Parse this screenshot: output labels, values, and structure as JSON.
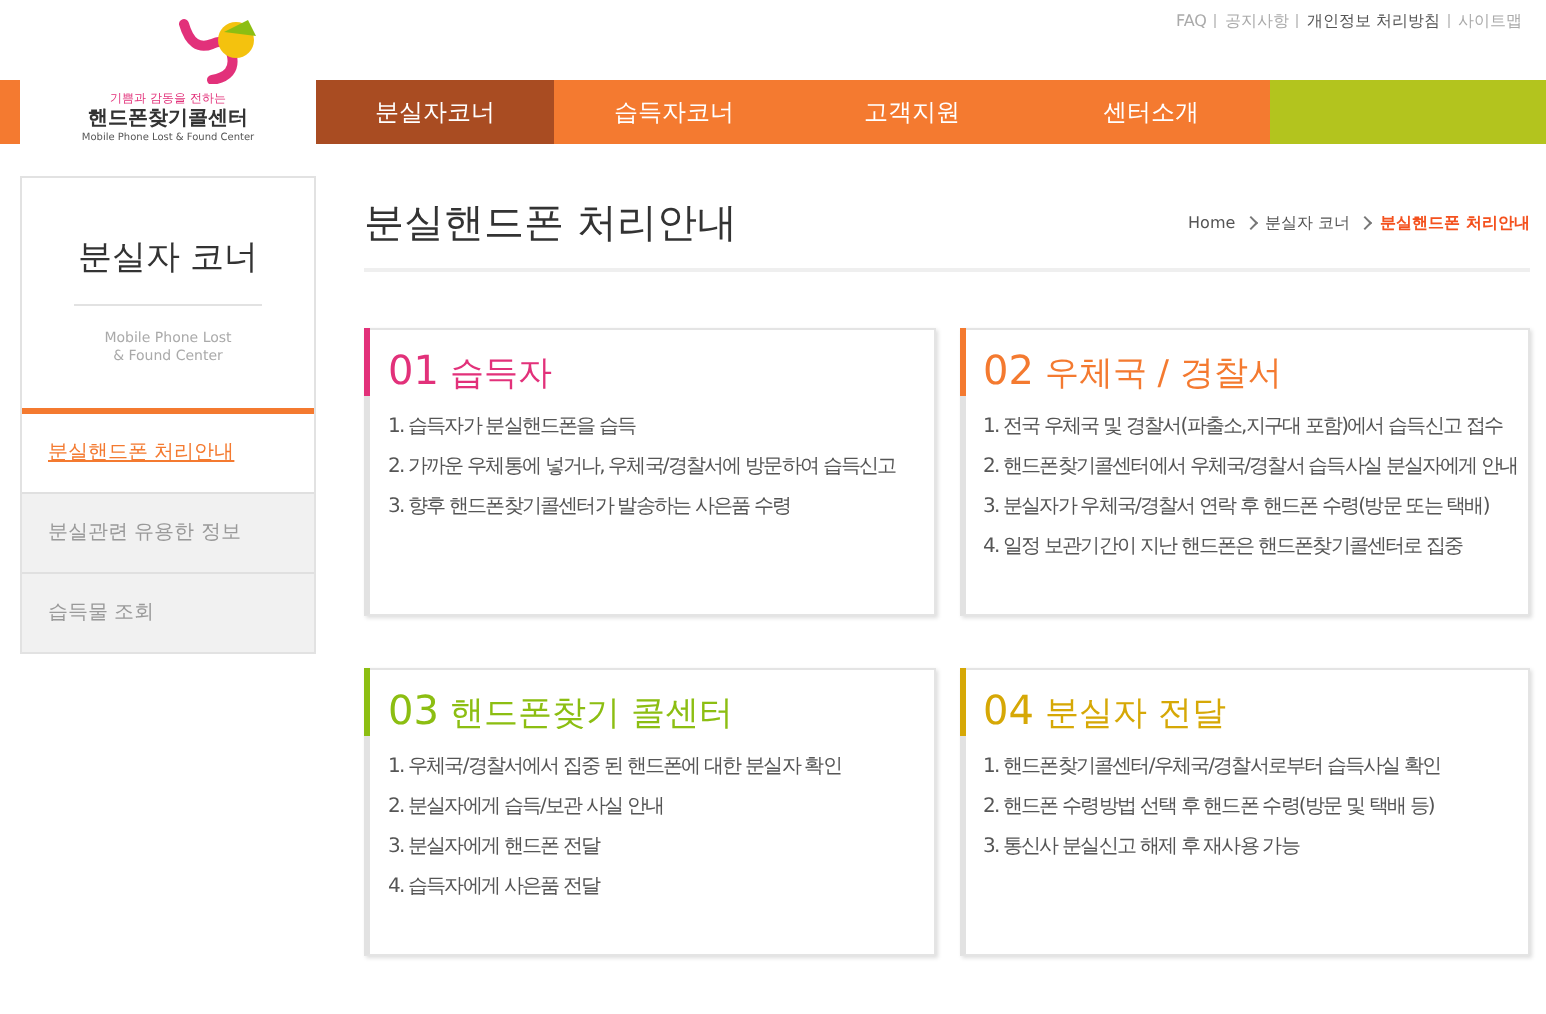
{
  "top_links": [
    "FAQ",
    "공지사항",
    "개인정보 처리방침",
    "사이트맵"
  ],
  "logo": {
    "tagline": "기쁨과 감동을 전하는",
    "name": "핸드폰찾기콜센터",
    "subtitle": "Mobile Phone Lost & Found Center"
  },
  "nav": [
    {
      "label": "분실자코너",
      "selected": true
    },
    {
      "label": "습득자코너",
      "selected": false
    },
    {
      "label": "고객지원",
      "selected": false
    },
    {
      "label": "센터소개",
      "selected": false
    }
  ],
  "sidebar": {
    "title": "분실자 코너",
    "subtitle": "Mobile Phone Lost\n& Found Center",
    "items": [
      {
        "label": "분실핸드폰 처리안내",
        "selected": true
      },
      {
        "label": "분실관련 유용한 정보",
        "selected": false
      },
      {
        "label": "습득물 조회",
        "selected": false
      }
    ]
  },
  "page_title": "분실핸드폰 처리안내",
  "breadcrumb": [
    "Home",
    "분실자 코너",
    "분실핸드폰 처리안내"
  ],
  "cards": [
    {
      "number": "01",
      "title": "습득자",
      "color": "#e2317a",
      "steps": [
        "1. 습득자가 분실핸드폰을 습득",
        "2. 가까운 우체통에 넣거나, 우체국/경찰서에 방문하여 습득신고",
        "3. 향후 핸드폰찾기콜센터가 발송하는 사은품 수령"
      ]
    },
    {
      "number": "02",
      "title": "우체국 / 경찰서",
      "color": "#f47a30",
      "steps": [
        "1. 전국 우체국 및 경찰서(파출소,지구대 포함)에서 습득신고 접수",
        "2. 핸드폰찾기콜센터에서 우체국/경찰서 습득사실 분실자에게 안내",
        "3. 분실자가 우체국/경찰서 연락 후 핸드폰 수령(방문 또는 택배)",
        "4. 일정 보관기간이 지난 핸드폰은 핸드폰찾기콜센터로 집중"
      ]
    },
    {
      "number": "03",
      "title": "핸드폰찾기 콜센터",
      "color": "#8cbe12",
      "steps": [
        "1. 우체국/경찰서에서 집중 된 핸드폰에 대한 분실자 확인",
        "2. 분실자에게 습득/보관 사실 안내",
        "3. 분실자에게 핸드폰 전달",
        "4. 습득자에게 사은품 전달"
      ]
    },
    {
      "number": "04",
      "title": "분실자 전달",
      "color": "#d6a806",
      "steps": [
        "1. 핸드폰찾기콜센터/우체국/경찰서로부터 습득사실 확인",
        "2. 핸드폰 수령방법 선택 후 핸드폰 수령(방문 및 택배 등)",
        "3. 통신사 분실신고 해제 후 재사용 가능"
      ]
    }
  ]
}
